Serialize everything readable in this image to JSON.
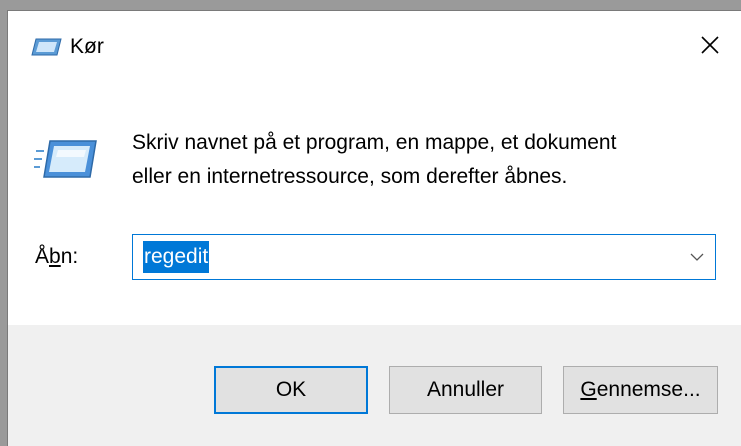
{
  "window": {
    "title": "Kør",
    "close_icon": "close-icon"
  },
  "content": {
    "description_line1": "Skriv navnet på et program, en mappe, et dokument",
    "description_line2": "eller en internetressource, som derefter åbnes.",
    "open_label_prefix": "Å",
    "open_label_underlined": "b",
    "open_label_suffix": "n:",
    "combo_value": "regedit"
  },
  "buttons": {
    "ok_label": "OK",
    "cancel_label": "Annuller",
    "browse_underlined": "G",
    "browse_rest": "ennemse..."
  },
  "colors": {
    "accent": "#0078d7",
    "button_bg": "#e1e1e1",
    "footer_bg": "#f0f0f0"
  }
}
